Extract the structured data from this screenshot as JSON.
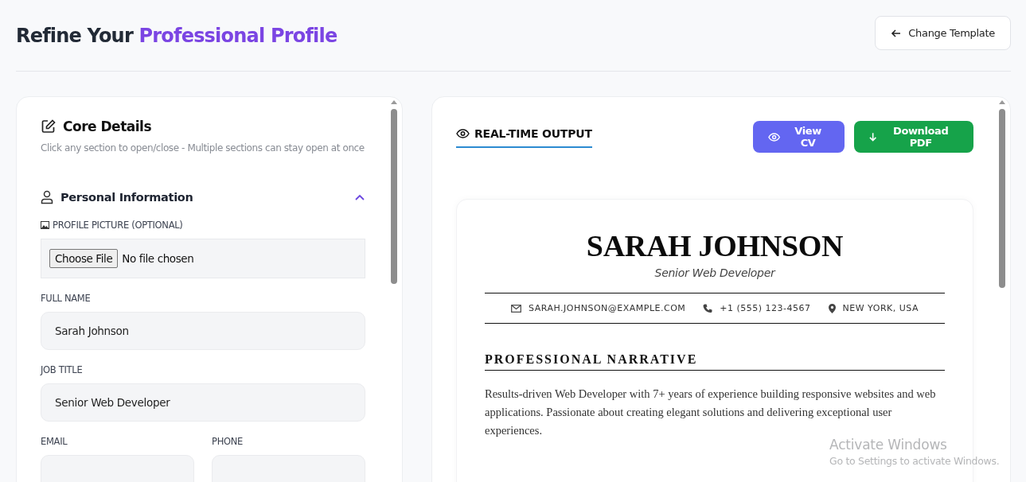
{
  "header": {
    "title_lead": "Refine Your",
    "title_highlight": "Professional Profile",
    "back_button": "Change Template"
  },
  "editor": {
    "title": "Core Details",
    "hint": "Click any section to open/close - Multiple sections can stay open at once",
    "section": {
      "title": "Personal Information",
      "expanded": true,
      "fields": [
        {
          "kind": "file",
          "label": "PROFILE PICTURE (OPTIONAL)",
          "button": "Choose File",
          "status": "No file chosen"
        },
        {
          "kind": "text",
          "label": "FULL NAME",
          "value": "Sarah Johnson"
        },
        {
          "kind": "text",
          "label": "JOB TITLE",
          "value": "Senior Web Developer"
        },
        {
          "kind": "pair",
          "items": [
            {
              "label": "EMAIL"
            },
            {
              "label": "PHONE"
            }
          ]
        }
      ]
    }
  },
  "preview": {
    "tabs": [
      {
        "label": "REAL-TIME OUTPUT",
        "selected": true
      }
    ],
    "buttons": [
      {
        "kind": "view",
        "label": "View CV"
      },
      {
        "kind": "download",
        "label": "Download PDF"
      }
    ],
    "resume": {
      "name": "SARAH JOHNSON",
      "role": "Senior Web Developer",
      "contacts": [
        {
          "kind": "email",
          "text": "SARAH.JOHNSON@EXAMPLE.COM"
        },
        {
          "kind": "phone",
          "text": "+1 (555) 123-4567"
        },
        {
          "kind": "location",
          "text": "NEW YORK, USA"
        }
      ],
      "section_title": "PROFESSIONAL NARRATIVE",
      "summary": "Results-driven Web Developer with 7+ years of experience building responsive websites and web applications. Passionate about creating elegant solutions and delivering exceptional user experiences."
    }
  },
  "os_overlay": {
    "title": "Activate Windows",
    "subtitle": "Go to Settings to activate Windows."
  }
}
